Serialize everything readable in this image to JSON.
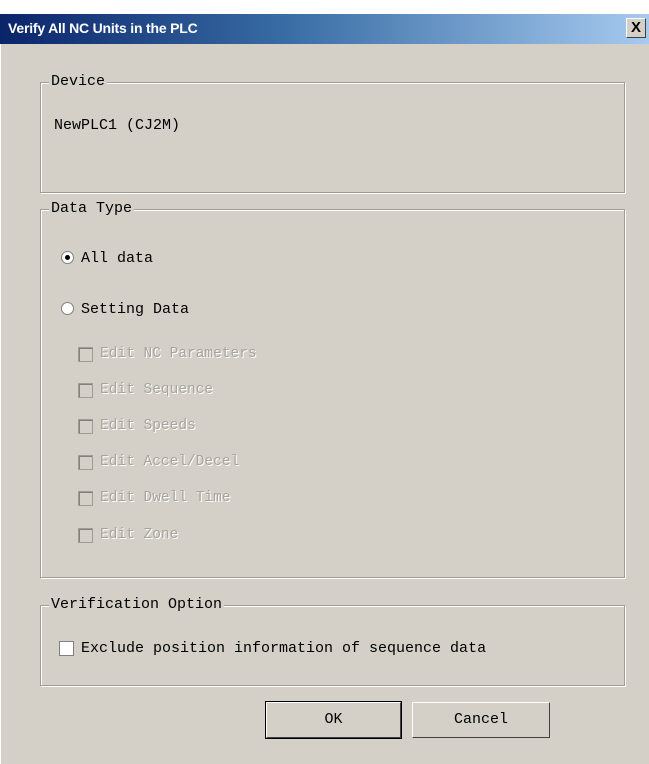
{
  "window": {
    "title": "Verify All NC Units in the PLC",
    "close_label": "X"
  },
  "device_group": {
    "legend": "Device",
    "value": "NewPLC1 (CJ2M)"
  },
  "data_type_group": {
    "legend": "Data Type",
    "options": [
      {
        "label": "All data",
        "selected": true
      },
      {
        "label": "Setting Data",
        "selected": false
      }
    ],
    "setting_items": [
      {
        "label": "Edit NC Parameters",
        "checked": false,
        "enabled": false
      },
      {
        "label": "Edit Sequence",
        "checked": false,
        "enabled": false
      },
      {
        "label": "Edit Speeds",
        "checked": false,
        "enabled": false
      },
      {
        "label": "Edit Accel/Decel",
        "checked": false,
        "enabled": false
      },
      {
        "label": "Edit Dwell Time",
        "checked": false,
        "enabled": false
      },
      {
        "label": "Edit Zone",
        "checked": false,
        "enabled": false
      }
    ]
  },
  "verification_group": {
    "legend": "Verification Option",
    "option_label": "Exclude position information of sequence data",
    "checked": false
  },
  "buttons": {
    "ok": "OK",
    "cancel": "Cancel"
  }
}
